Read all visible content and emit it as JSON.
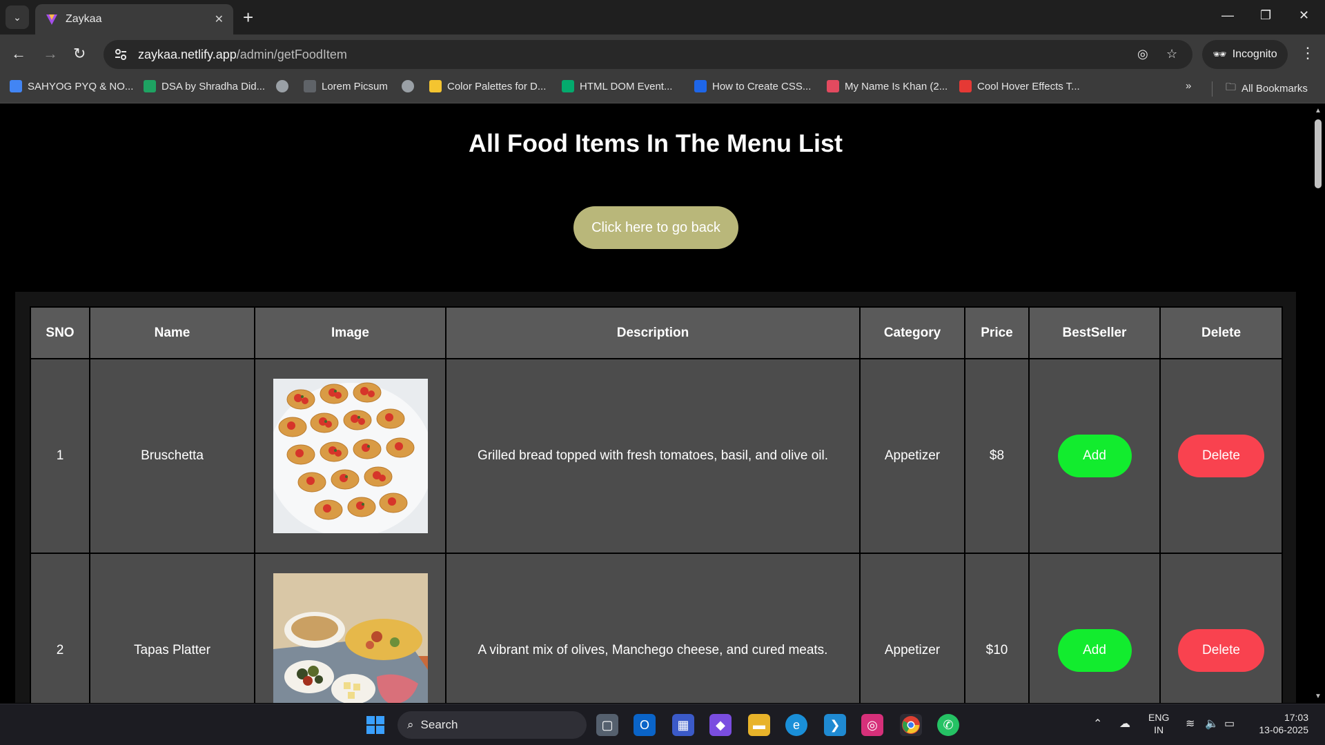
{
  "browser": {
    "tab_title": "Zaykaa",
    "url_host": "zaykaa.netlify.app",
    "url_path": "/admin/getFoodItem",
    "incognito_label": "Incognito",
    "bookmarks": [
      {
        "label": "SAHYOG PYQ & NO...",
        "color": "#4285f4"
      },
      {
        "label": "DSA by Shradha Did...",
        "color": "#1ea362"
      },
      {
        "label": "",
        "color": "#9aa0a6"
      },
      {
        "label": "Lorem Picsum",
        "color": "#5f6368"
      },
      {
        "label": "",
        "color": "#9aa0a6"
      },
      {
        "label": "Color Palettes for D...",
        "color": "#f4c430"
      },
      {
        "label": "HTML DOM Event...",
        "color": "#04aa6d"
      },
      {
        "label": "How to Create CSS...",
        "color": "#1e66e8"
      },
      {
        "label": "My Name Is Khan (2...",
        "color": "#e34a5f"
      },
      {
        "label": "Cool Hover Effects T...",
        "color": "#e53935"
      }
    ],
    "all_bookmarks_label": "All Bookmarks"
  },
  "page": {
    "title": "All Food Items In The Menu List",
    "back_button": "Click here to go back",
    "table": {
      "headers": [
        "SNO",
        "Name",
        "Image",
        "Description",
        "Category",
        "Price",
        "BestSeller",
        "Delete"
      ],
      "rows": [
        {
          "sno": "1",
          "name": "Bruschetta",
          "image": "bruschetta-photo",
          "description": "Grilled bread topped with fresh tomatoes, basil, and olive oil.",
          "category": "Appetizer",
          "price": "$8",
          "bestseller_button": "Add",
          "delete_button": "Delete"
        },
        {
          "sno": "2",
          "name": "Tapas Platter",
          "image": "tapas-platter-photo",
          "description": "A vibrant mix of olives, Manchego cheese, and cured meats.",
          "category": "Appetizer",
          "price": "$10",
          "bestseller_button": "Add",
          "delete_button": "Delete"
        }
      ]
    }
  },
  "taskbar": {
    "search_label": "Search",
    "lang_line1": "ENG",
    "lang_line2": "IN",
    "time": "17:03",
    "date": "13-06-2025"
  },
  "colors": {
    "back_button": "#b9b77a",
    "add_button": "#12ec2e",
    "delete_button": "#f9424f"
  }
}
